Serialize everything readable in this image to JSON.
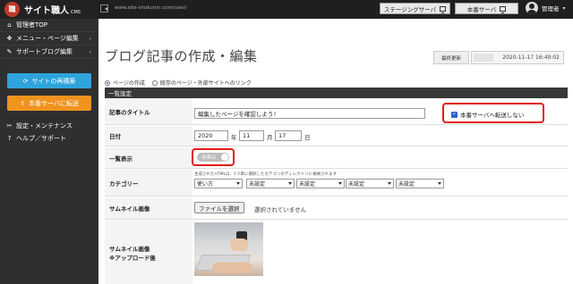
{
  "topbar": {
    "logo_text": "サイト職人",
    "logo_sub": "CMS",
    "url": "www.site-shokunin.com/user/",
    "staging_button": "ステージングサーバ",
    "production_button": "本番サーバ",
    "user_name": "管理者"
  },
  "sidebar": {
    "items": [
      {
        "label": "管理者TOP",
        "icon": "home-icon"
      },
      {
        "label": "メニュー・ページ編集",
        "icon": "arrows-icon"
      },
      {
        "label": "サポートブログ編集",
        "icon": "edit-icon"
      }
    ],
    "rebuild_button": "サイトの再構築",
    "transfer_button": "本番サーバに転送",
    "bottom_items": [
      {
        "label": "設定・メンテナンス",
        "icon": "wrench-icon"
      },
      {
        "label": "ヘルプ／サポート",
        "icon": "question-icon"
      }
    ],
    "colors": {
      "rebuild": "#2ea3dc",
      "transfer": "#f0931f"
    }
  },
  "main": {
    "title": "ブログ記事の作成・編集",
    "updated_label": "最終更新",
    "updated_value": "2020-11-17 16:49:02",
    "radio_create": "ページの作成",
    "radio_link": "既存のページ・外部サイトへのリンク",
    "section_title": "一覧設定",
    "fields": {
      "title_label": "記事のタイトル",
      "title_value": "編集したページを確認しよう！",
      "transfer_checkbox": "本番サーバへ転送しない",
      "date_label": "日付",
      "date_year": "2020",
      "date_year_unit": "年",
      "date_month": "11",
      "date_month_unit": "月",
      "date_day": "17",
      "date_day_unit": "日",
      "display_label": "一覧表示",
      "display_toggle": "非表示",
      "category_label": "カテゴリー",
      "category_note": "生成されたHTMLは、1つ目に選択したカテゴリのディレクトリに格納されます",
      "category_selects": [
        "使い方",
        "未設定",
        "未設定",
        "未設定",
        "未設定"
      ],
      "thumb_label": "サムネイル画像",
      "file_button": "ファイルを選択",
      "file_status": "選択されていません",
      "thumb_after_label_1": "サムネイル画像",
      "thumb_after_label_2": "※アップロード後"
    },
    "highlight_color": "#e31b1b"
  }
}
